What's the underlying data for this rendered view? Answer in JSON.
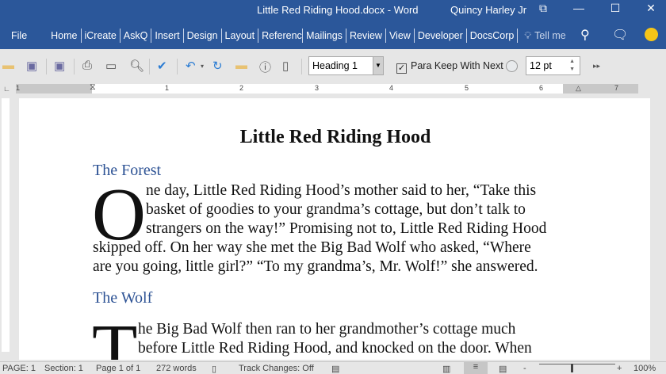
{
  "window": {
    "title": "Little Red Riding Hood.docx  -  Word",
    "user": "Quincy Harley Jr",
    "ribbon_display_icon": "⧉",
    "minimize_icon": "—",
    "maximize_icon": "☐",
    "close_icon": "✕"
  },
  "tabs": [
    "File",
    "Home",
    "iCreate",
    "AskQ",
    "Insert",
    "Design",
    "Layout",
    "References",
    "Mailings",
    "Review",
    "View",
    "Developer",
    "DocsCorp"
  ],
  "tell_me": "Tell me",
  "toolbar": {
    "style": "Heading 1",
    "keep_with_next": "Para Keep With Next",
    "font_size": "12 pt"
  },
  "ruler": {
    "labels": [
      "1",
      "1",
      "2",
      "3",
      "4",
      "5",
      "6",
      "7"
    ]
  },
  "document": {
    "title": "Little Red Riding Hood",
    "heading1": "The Forest",
    "drop_cap1": "O",
    "para1": [
      "ne day, Little Red Riding Hood’s mother said to her, “Take this",
      "basket of goodies to your grandma’s cottage, but don’t talk to",
      "strangers on the way!” Promising not to, Little Red Riding Hood",
      "skipped off. On her way she met the Big Bad Wolf who asked, “Where",
      "are you going, little girl?” “To my grandma’s, Mr. Wolf!” she answered."
    ],
    "heading2": "The Wolf",
    "drop_cap2": "T",
    "para2": [
      "he Big Bad Wolf then ran to her grandmother’s cottage much",
      "before Little Red Riding Hood, and knocked on the door. When"
    ]
  },
  "status": {
    "page": "PAGE: 1",
    "section": "Section: 1",
    "page_of": "Page 1 of 1",
    "words": "272 words",
    "track_changes": "Track Changes: Off",
    "zoom": "100%",
    "zoom_out": "-",
    "zoom_in": "+"
  }
}
